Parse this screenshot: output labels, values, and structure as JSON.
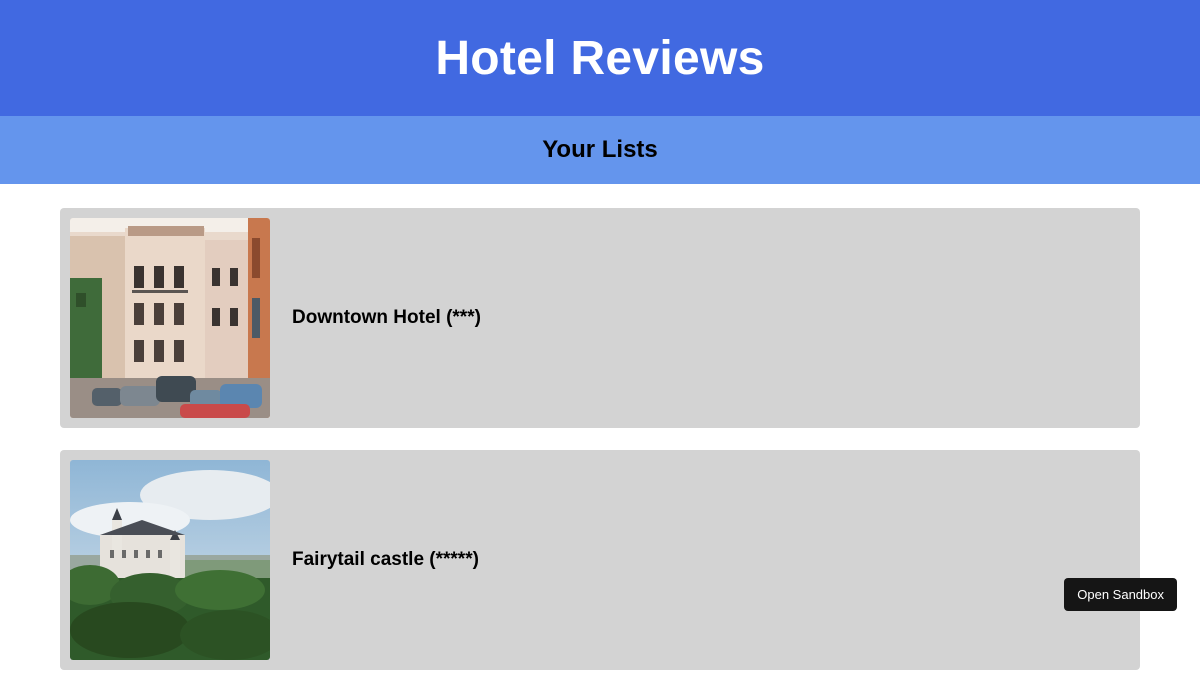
{
  "header": {
    "title": "Hotel Reviews"
  },
  "subheader": {
    "title": "Your Lists"
  },
  "hotels": [
    {
      "name": "Downtown Hotel (***)",
      "image": "street-photo"
    },
    {
      "name": "Fairytail castle (*****)",
      "image": "castle-photo"
    }
  ],
  "sandbox": {
    "label": "Open Sandbox"
  },
  "colors": {
    "header_bg": "#4169e1",
    "subheader_bg": "#6495ed",
    "card_bg": "#d3d3d3",
    "button_bg": "#151515"
  }
}
